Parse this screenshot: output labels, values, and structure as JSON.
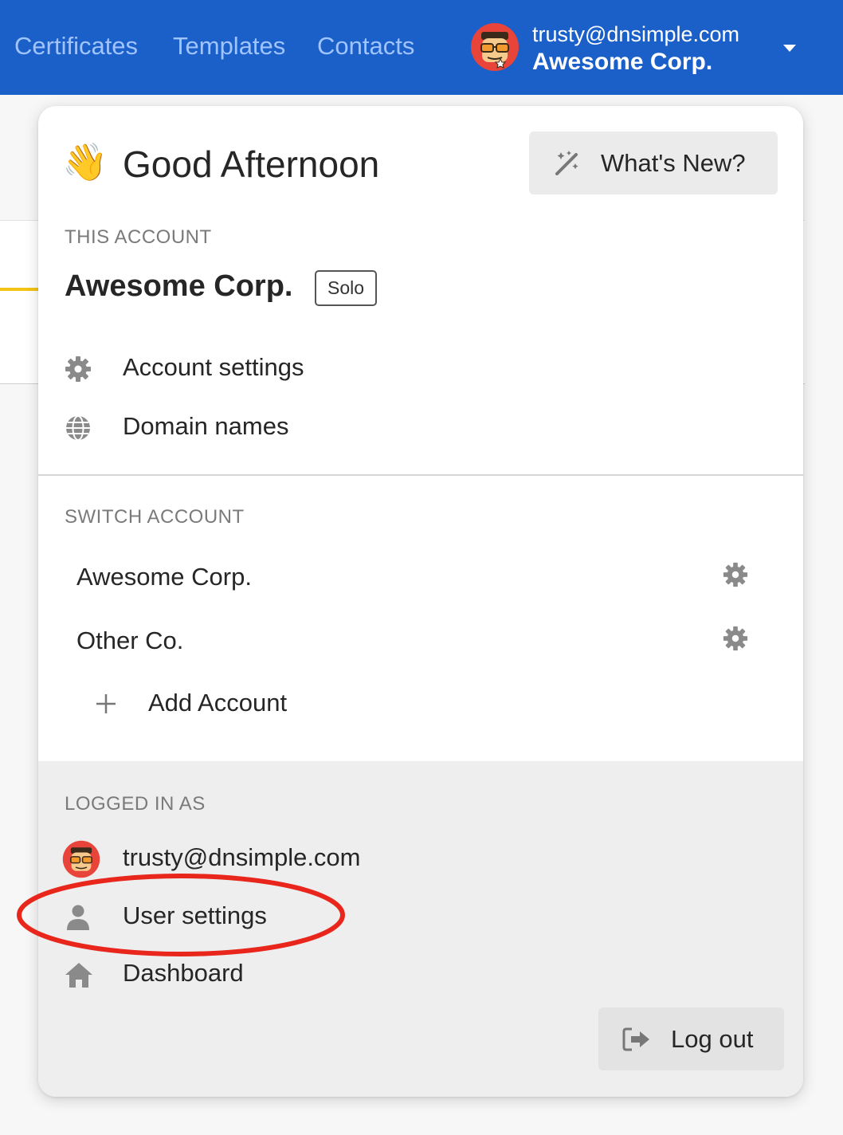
{
  "topnav": {
    "links": [
      "Certificates",
      "Templates",
      "Contacts"
    ],
    "user_email": "trusty@dnsimple.com",
    "account_name": "Awesome Corp.",
    "brand_color": "#1b5fc8"
  },
  "panel": {
    "greeting": "Good Afternoon",
    "greeting_emoji": "👋",
    "whats_new_label": "What's New?",
    "this_account": {
      "section_label": "THIS ACCOUNT",
      "name": "Awesome Corp.",
      "plan_badge": "Solo",
      "items": [
        {
          "label": "Account settings",
          "icon": "gear-icon"
        },
        {
          "label": "Domain names",
          "icon": "globe-icon"
        }
      ]
    },
    "switch_account": {
      "section_label": "SWITCH ACCOUNT",
      "accounts": [
        {
          "name": "Awesome Corp.",
          "icon": "gear-icon"
        },
        {
          "name": "Other Co.",
          "icon": "gear-icon"
        }
      ],
      "add_label": "Add Account"
    },
    "logged_in_as": {
      "section_label": "LOGGED IN AS",
      "email": "trusty@dnsimple.com",
      "items": [
        {
          "label": "User settings",
          "icon": "user-icon"
        },
        {
          "label": "Dashboard",
          "icon": "home-icon"
        }
      ],
      "logout_label": "Log out"
    }
  },
  "annotation": {
    "highlight_color": "#e8261c",
    "highlighted_item": "User settings"
  }
}
